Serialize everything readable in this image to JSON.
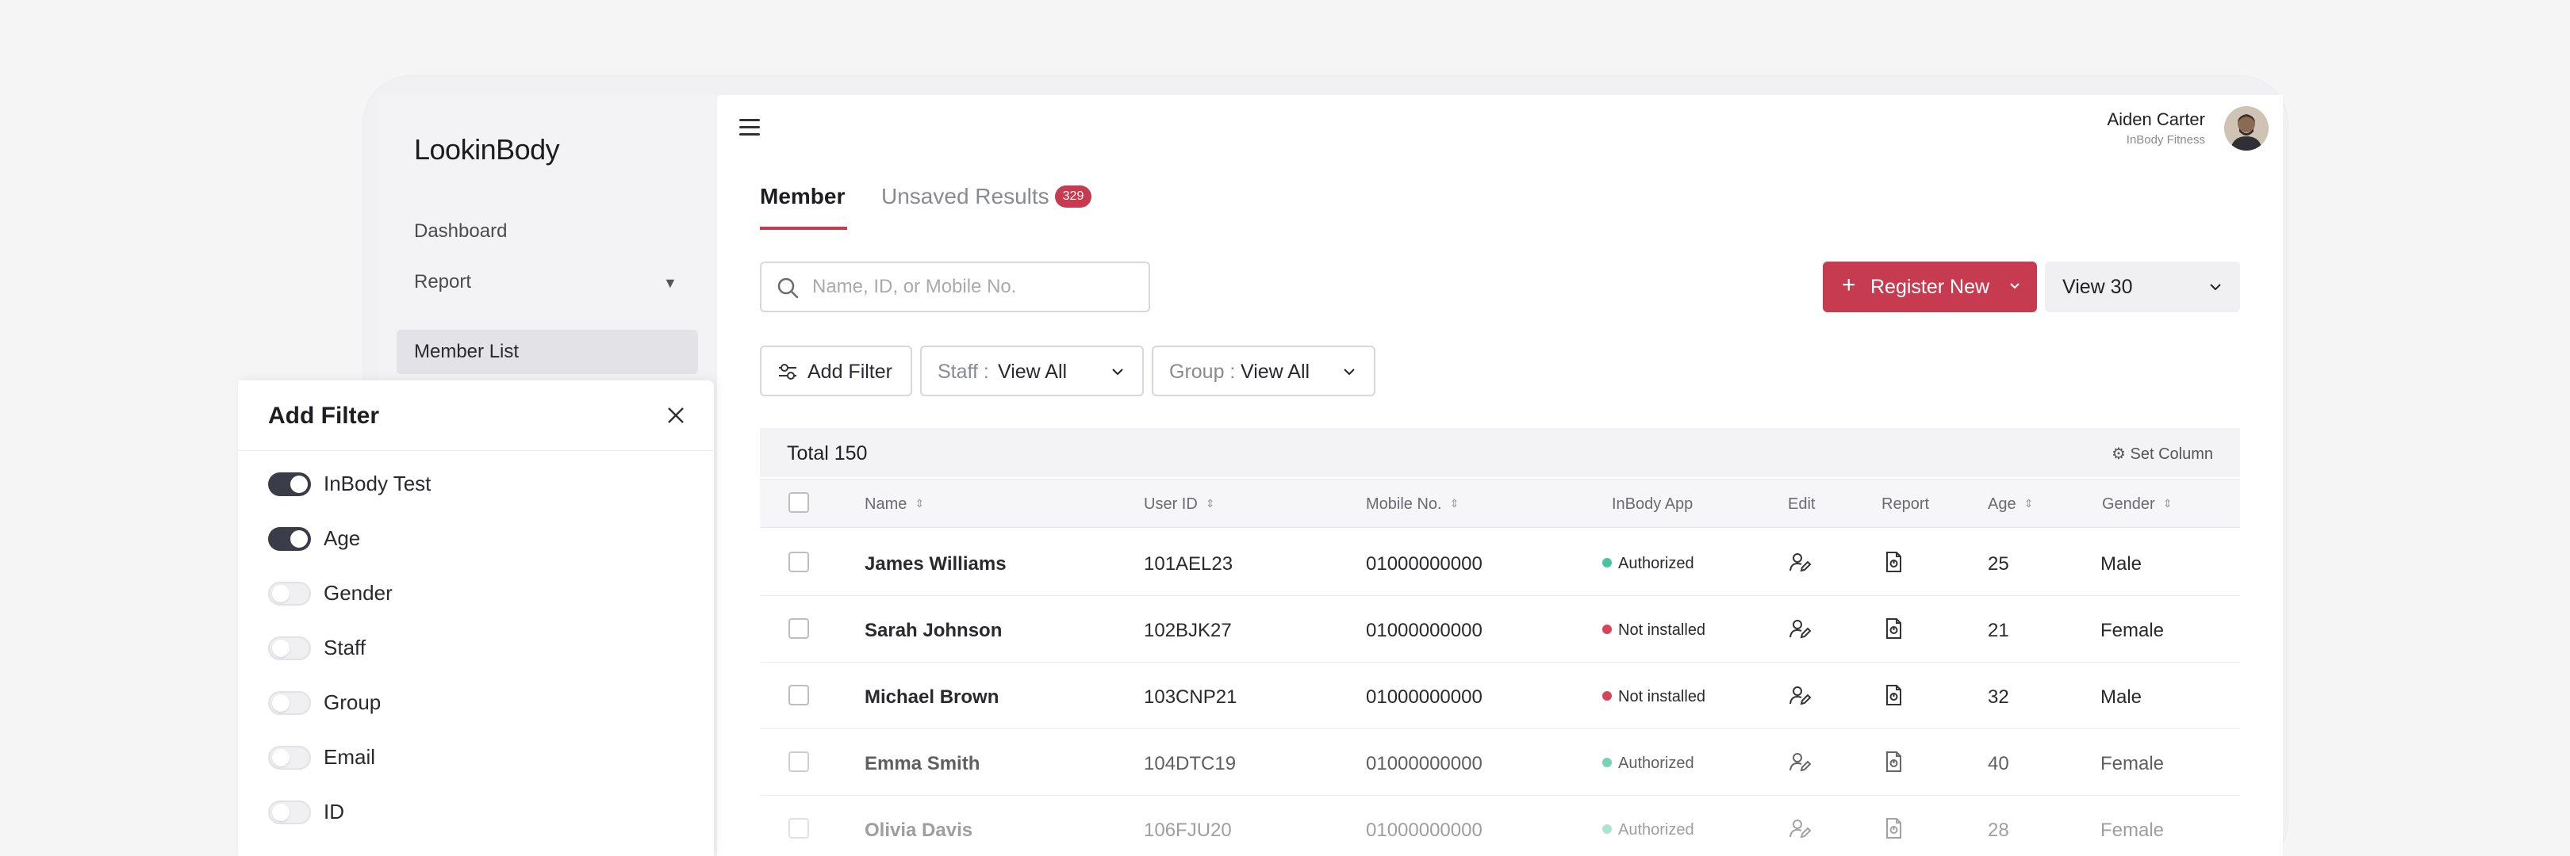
{
  "sidebar": {
    "logo": "LookinBody",
    "items": [
      {
        "label": "Dashboard"
      },
      {
        "label": "Report"
      },
      {
        "label": "Member List"
      }
    ]
  },
  "header": {
    "user_name": "Aiden Carter",
    "user_org": "InBody Fitness"
  },
  "tabs": [
    {
      "label": "Member",
      "active": true
    },
    {
      "label": "Unsaved Results",
      "badge": "329"
    }
  ],
  "search": {
    "placeholder": "Name, ID, or Mobile No."
  },
  "toolbar": {
    "register_label": "Register New",
    "view_label": "View 30"
  },
  "filters": {
    "add_filter_label": "Add Filter",
    "staff_key": "Staff :",
    "staff_value": "View All",
    "group_key": "Group :",
    "group_value": "View All"
  },
  "table": {
    "total_label": "Total 150",
    "set_column_label": "Set Column",
    "columns": [
      "Name",
      "User ID",
      "Mobile No.",
      "InBody App",
      "Edit",
      "Report",
      "Age",
      "Gender"
    ],
    "rows": [
      {
        "name": "James Williams",
        "user_id": "101AEL23",
        "mobile": "01000000000",
        "app": "Authorized",
        "app_status": "ok",
        "age": "25",
        "gender": "Male"
      },
      {
        "name": "Sarah Johnson",
        "user_id": "102BJK27",
        "mobile": "01000000000",
        "app": "Not installed",
        "app_status": "no",
        "age": "21",
        "gender": "Female"
      },
      {
        "name": "Michael Brown",
        "user_id": "103CNP21",
        "mobile": "01000000000",
        "app": "Not installed",
        "app_status": "no",
        "age": "32",
        "gender": "Male"
      },
      {
        "name": "Emma Smith",
        "user_id": "104DTC19",
        "mobile": "01000000000",
        "app": "Authorized",
        "app_status": "ok",
        "age": "40",
        "gender": "Female"
      },
      {
        "name": "Olivia Davis",
        "user_id": "106FJU20",
        "mobile": "01000000000",
        "app": "Authorized",
        "app_status": "ok",
        "age": "28",
        "gender": "Female"
      }
    ]
  },
  "filter_panel": {
    "title": "Add Filter",
    "options": [
      {
        "label": "InBody Test",
        "on": true
      },
      {
        "label": "Age",
        "on": true
      },
      {
        "label": "Gender",
        "on": false
      },
      {
        "label": "Staff",
        "on": false
      },
      {
        "label": "Group",
        "on": false
      },
      {
        "label": "Email",
        "on": false
      },
      {
        "label": "ID",
        "on": false
      }
    ]
  },
  "colors": {
    "accent": "#c63b4f",
    "status_ok": "#4cc3a0",
    "status_no": "#d6455a",
    "toggle_on": "#3a3d48"
  }
}
